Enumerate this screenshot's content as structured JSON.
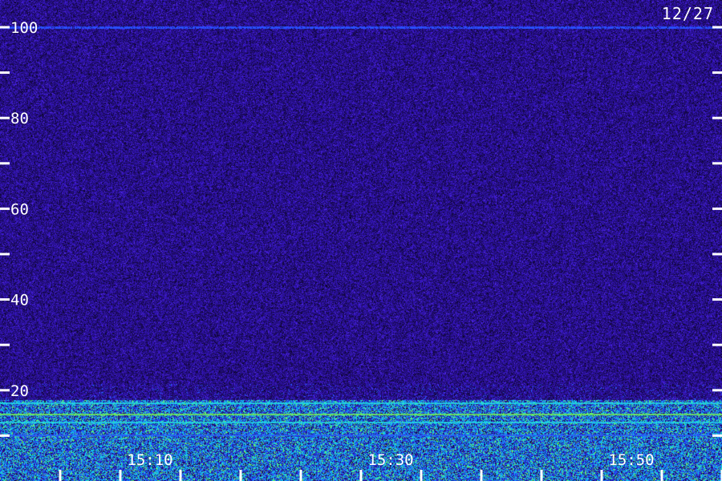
{
  "date_label": "12/27",
  "colors": {
    "background": "#1a0c52",
    "noise_mid": "#3a1aa8",
    "noise_high": "#5a2ee0",
    "line_blue": "#2a5cff",
    "band_cyan": "#22e6e6",
    "band_green": "#7cff4a",
    "axis": "#ffffff"
  },
  "chart_data": {
    "type": "heatmap",
    "title": "",
    "xlabel": "",
    "ylabel": "",
    "y_ticks": [
      {
        "value": 100,
        "label": "100"
      },
      {
        "value": 90,
        "label": ""
      },
      {
        "value": 80,
        "label": "80"
      },
      {
        "value": 70,
        "label": ""
      },
      {
        "value": 60,
        "label": "60"
      },
      {
        "value": 50,
        "label": ""
      },
      {
        "value": 40,
        "label": "40"
      },
      {
        "value": 30,
        "label": ""
      },
      {
        "value": 20,
        "label": "20"
      },
      {
        "value": 10,
        "label": ""
      }
    ],
    "ylim": [
      0,
      106
    ],
    "x_ticks": [
      {
        "value": "15:05",
        "label": ""
      },
      {
        "value": "15:10",
        "label": "15:10"
      },
      {
        "value": "15:15",
        "label": ""
      },
      {
        "value": "15:20",
        "label": ""
      },
      {
        "value": "15:25",
        "label": ""
      },
      {
        "value": "15:30",
        "label": "15:30"
      },
      {
        "value": "15:35",
        "label": ""
      },
      {
        "value": "15:40",
        "label": ""
      },
      {
        "value": "15:45",
        "label": ""
      },
      {
        "value": "15:50",
        "label": "15:50"
      },
      {
        "value": "15:55",
        "label": ""
      },
      {
        "value": "16:00",
        "label": ""
      }
    ],
    "xlim": [
      "15:00",
      "16:00"
    ],
    "features": [
      {
        "kind": "persistent_line",
        "y": 100,
        "intensity": "medium"
      },
      {
        "kind": "low_band",
        "y_range": [
          0,
          18
        ],
        "intensity": "high"
      }
    ],
    "grid": false,
    "legend": "none"
  }
}
